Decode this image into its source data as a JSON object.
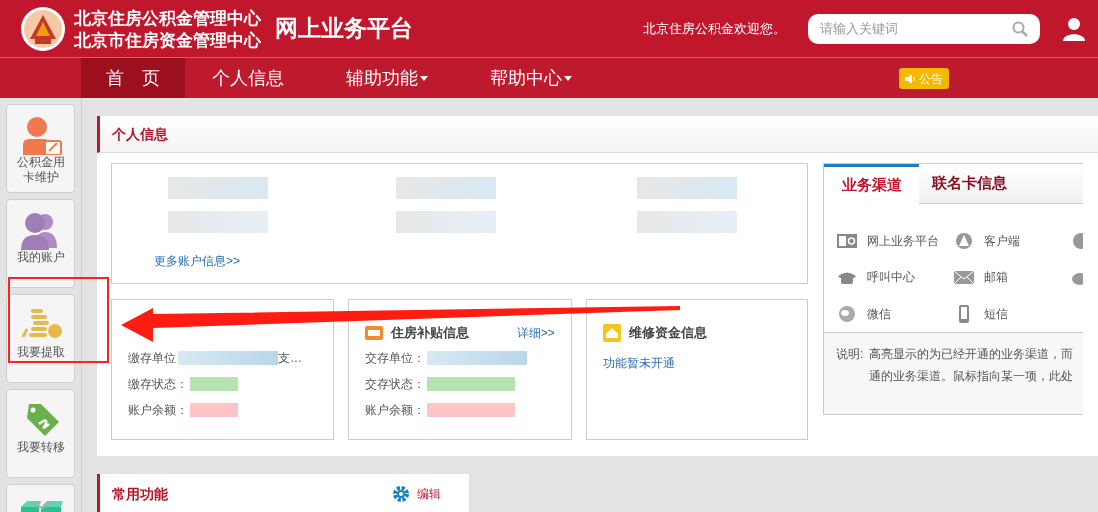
{
  "header": {
    "org_lines": [
      "北京住房公积金管理中心",
      "北京市住房资金管理中心"
    ],
    "platform": "网上业务平台",
    "welcome": "北京住房公积金欢迎您。",
    "search": {
      "placeholder": "请输入关键词"
    }
  },
  "nav": [
    {
      "label": "首　页",
      "selected": true,
      "dropdown": false
    },
    {
      "label": "个人信息",
      "selected": false,
      "dropdown": false
    },
    {
      "label": "辅助功能",
      "selected": false,
      "dropdown": true
    },
    {
      "label": "帮助中心",
      "selected": false,
      "dropdown": true
    }
  ],
  "notice": "公告",
  "sidebar": [
    {
      "kind": "card",
      "label": "公积金用卡维护"
    },
    {
      "kind": "people",
      "label": "我的账户"
    },
    {
      "kind": "coins",
      "label": "我要提取"
    },
    {
      "kind": "tag",
      "label": "我要转移"
    },
    {
      "kind": "boxes"
    }
  ],
  "personal": {
    "title": "个人信息",
    "more_link": "更多账户信息>>",
    "cards": [
      {
        "kind": "none",
        "rows": [
          {
            "label": "缴存单位",
            "tail": "支…"
          },
          {
            "label": "缴存状态："
          },
          {
            "label": "账户余额："
          }
        ]
      },
      {
        "kind": "subsidy",
        "title": "住房补贴信息",
        "link": "详细>>",
        "rows": [
          {
            "label": "交存单位："
          },
          {
            "label": "交存状态："
          },
          {
            "label": "账户余额："
          }
        ]
      },
      {
        "kind": "repair",
        "title": "维修资金信息",
        "note": "功能暂未开通"
      }
    ]
  },
  "channels_panel": {
    "tabs": [
      {
        "label": "业务渠道",
        "selected": true
      },
      {
        "label": "联名卡信息",
        "selected": false
      }
    ],
    "channels": [
      {
        "kind": "web",
        "label": "网上业务平台"
      },
      {
        "kind": "client",
        "label": "客户端"
      },
      {
        "kind": "w"
      },
      {
        "kind": "phone",
        "label": "呼叫中心"
      },
      {
        "kind": "mail",
        "label": "邮箱"
      },
      {
        "kind": "weibo"
      },
      {
        "kind": "wechat",
        "label": "微信"
      },
      {
        "kind": "mobile",
        "label": "短信"
      }
    ],
    "note_label": "说明:",
    "note_lines": [
      "高亮显示的为已经开通的业务渠道，而",
      "通的业务渠道。鼠标指向某一项，此处"
    ]
  },
  "common": {
    "title": "常用功能",
    "edit": "编辑"
  }
}
